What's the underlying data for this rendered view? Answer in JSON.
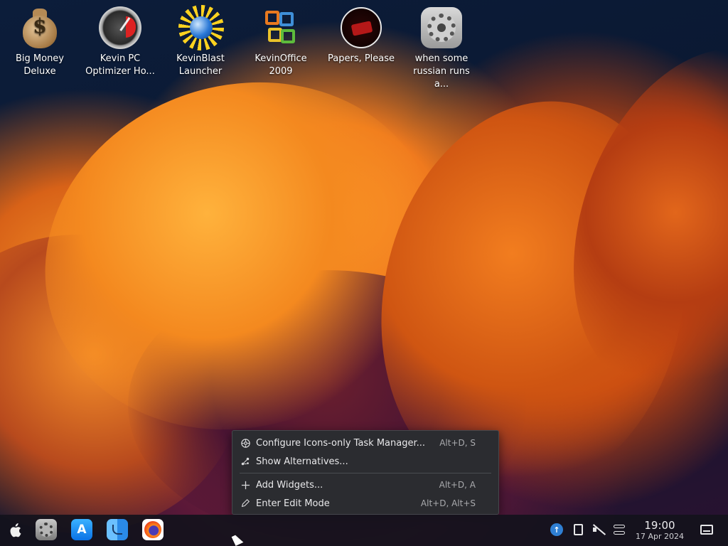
{
  "desktop": {
    "icons": [
      {
        "label": "Big Money\nDeluxe",
        "icon": "money-bag-icon"
      },
      {
        "label": "Kevin PC\nOptimizer Ho...",
        "icon": "gauge-icon"
      },
      {
        "label": "KevinBlast\nLauncher",
        "icon": "globe-burst-icon"
      },
      {
        "label": "KevinOffice\n2009",
        "icon": "office-icon"
      },
      {
        "label": "Papers, Please",
        "icon": "papers-emblem-icon"
      },
      {
        "label": "when some\nrussian runs a...",
        "icon": "gear-icon"
      }
    ]
  },
  "context_menu": {
    "items": [
      {
        "label": "Configure Icons-only Task Manager...",
        "shortcut": "Alt+D, S",
        "icon": "configure-icon"
      },
      {
        "label": "Show Alternatives...",
        "shortcut": "",
        "icon": "alternatives-icon"
      },
      {
        "label": "Add Widgets...",
        "shortcut": "Alt+D, A",
        "icon": "plus-icon"
      },
      {
        "label": "Enter Edit Mode",
        "shortcut": "Alt+D, Alt+S",
        "icon": "pencil-icon"
      }
    ]
  },
  "taskbar": {
    "launcher_icon": "apple-icon",
    "apps": [
      {
        "name": "System Settings",
        "icon": "settings-icon"
      },
      {
        "name": "App Store",
        "icon": "app-store-icon",
        "glyph": "A"
      },
      {
        "name": "Finder",
        "icon": "finder-icon"
      },
      {
        "name": "Firefox",
        "icon": "firefox-icon"
      }
    ],
    "tray": {
      "update_glyph": "↑",
      "icons": [
        "update-icon",
        "clipboard-icon",
        "volume-muted-icon",
        "toggle-icon"
      ]
    },
    "clock": {
      "time": "19:00",
      "date": "17 Apr 2024"
    }
  },
  "colors": {
    "menu_bg": "#2b2c30",
    "menu_text": "#e8e8ea",
    "taskbar_bg": "#14121c",
    "accent_update": "#2f7fd3"
  }
}
